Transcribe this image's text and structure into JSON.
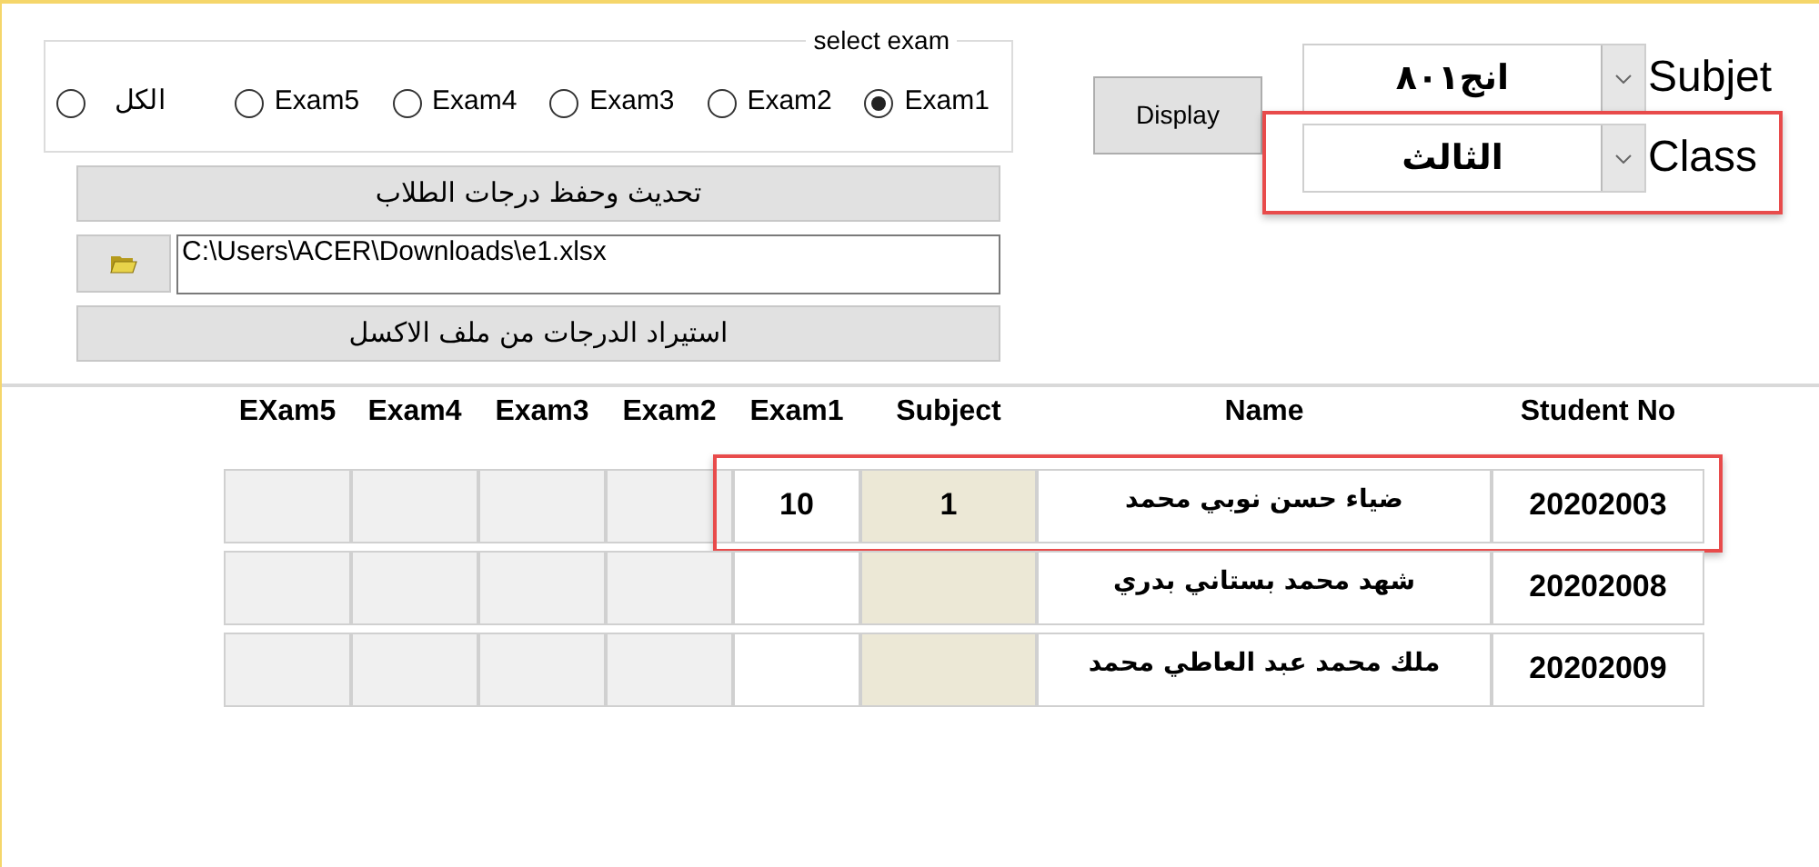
{
  "exam_group": {
    "legend": "select exam",
    "options": [
      {
        "label": "الكل",
        "selected": false
      },
      {
        "label": "Exam5",
        "selected": false
      },
      {
        "label": "Exam4",
        "selected": false
      },
      {
        "label": "Exam3",
        "selected": false
      },
      {
        "label": "Exam2",
        "selected": false
      },
      {
        "label": "Exam1",
        "selected": true
      }
    ]
  },
  "update_button": "تحديث وحفظ درجات الطلاب",
  "file_path": "C:\\Users\\ACER\\Downloads\\e1.xlsx",
  "import_button": "استيراد الدرجات من ملف الاكسل",
  "display_button": "Display",
  "selectors": [
    {
      "label": "Subjet",
      "value": "انج٨٠١",
      "highlighted": false
    },
    {
      "label": "Class",
      "value": "الثالث",
      "highlighted": true
    }
  ],
  "table": {
    "columns": [
      {
        "label": "EXam5",
        "kind": "exam",
        "enabled": false
      },
      {
        "label": "Exam4",
        "kind": "exam",
        "enabled": false
      },
      {
        "label": "Exam3",
        "kind": "exam",
        "enabled": false
      },
      {
        "label": "Exam2",
        "kind": "exam",
        "enabled": false
      },
      {
        "label": "Exam1",
        "kind": "exam",
        "enabled": true
      },
      {
        "label": "Subject",
        "kind": "subject"
      },
      {
        "label": "Name",
        "kind": "name"
      },
      {
        "label": "Student No",
        "kind": "id"
      }
    ],
    "rows": [
      {
        "highlighted": true,
        "cells": [
          "",
          "",
          "",
          "",
          "10",
          "1",
          "ضياء حسن نوبي محمد",
          "20202003"
        ]
      },
      {
        "highlighted": false,
        "cells": [
          "",
          "",
          "",
          "",
          "",
          "",
          "شهد محمد بستاني بدري",
          "20202008"
        ]
      },
      {
        "highlighted": false,
        "cells": [
          "",
          "",
          "",
          "",
          "",
          "",
          "ملك محمد عبد العاطي محمد",
          "20202009"
        ]
      }
    ]
  }
}
